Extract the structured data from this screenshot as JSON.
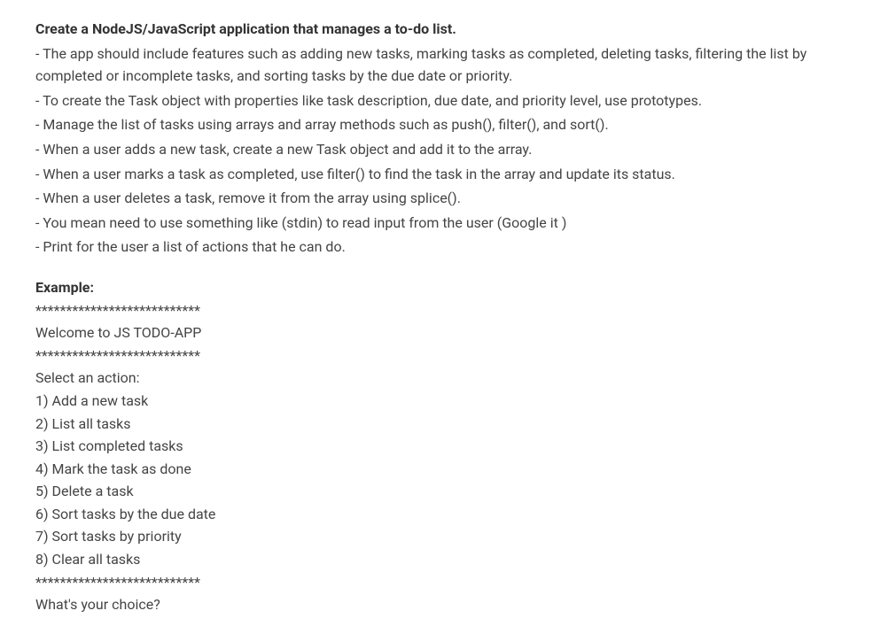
{
  "heading": "Create a NodeJS/JavaScript application that manages a to-do list.",
  "bullets": [
    "- The app should include features such as adding new tasks, marking tasks as completed, deleting tasks, filtering the list by completed or incomplete tasks, and sorting tasks by the due date or priority.",
    "- To create the Task object with properties like task description, due date, and priority level, use prototypes.",
    "- Manage the list of tasks using arrays and array methods such as push(), filter(), and sort().",
    "- When a user adds a new task, create a new Task object and add it to the array.",
    "- When a user marks a task as completed, use filter() to find the task in the array and update its status.",
    "- When a user deletes a task, remove it from the array using splice().",
    "- You mean need to use something like (stdin) to read input from the user (Google it  )",
    "- Print for the user a list of actions that he can do."
  ],
  "example_label": "Example:",
  "example_lines": [
    "***************************",
    "Welcome to JS TODO-APP",
    "***************************",
    "Select an action:",
    "1) Add a new task",
    "2) List all tasks",
    "3) List completed tasks",
    "4) Mark the task as done",
    "5) Delete a task",
    "6) Sort tasks by the due date",
    "7) Sort tasks by priority",
    "8) Clear all tasks",
    "***************************",
    "What's your choice?"
  ]
}
